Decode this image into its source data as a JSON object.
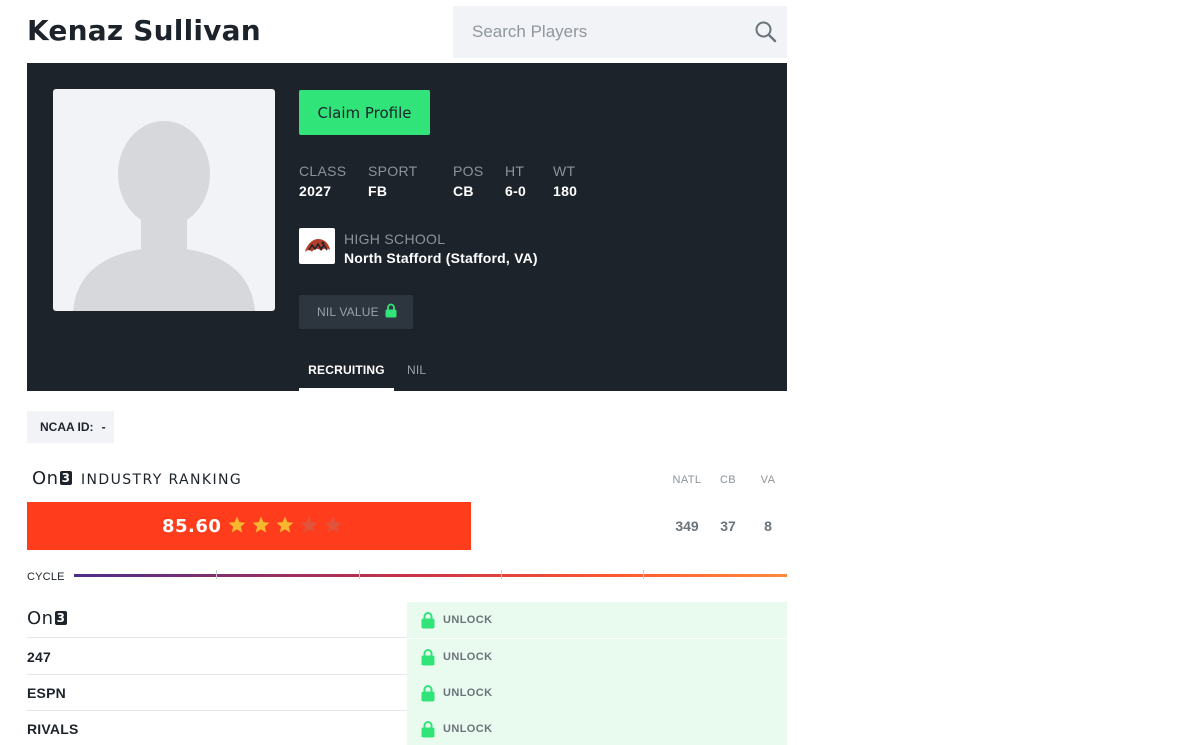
{
  "player": {
    "name": "Kenaz Sullivan"
  },
  "search": {
    "placeholder": "Search Players"
  },
  "profile": {
    "claim_label": "Claim Profile",
    "stats": [
      {
        "label": "CLASS",
        "value": "2027"
      },
      {
        "label": "SPORT",
        "value": "FB"
      },
      {
        "label": "POS",
        "value": "CB"
      },
      {
        "label": "HT",
        "value": "6-0"
      },
      {
        "label": "WT",
        "value": "180"
      }
    ],
    "high_school": {
      "label": "HIGH SCHOOL",
      "value": "North Stafford (Stafford, VA)"
    },
    "nil_label": "NIL VALUE",
    "tabs": [
      {
        "label": "RECRUITING",
        "active": true
      },
      {
        "label": "NIL",
        "active": false
      }
    ]
  },
  "ncaa": {
    "label": "NCAA ID:",
    "value": "-"
  },
  "ranking": {
    "brand": "On",
    "brand_num": "3",
    "title": "INDUSTRY RANKING",
    "score": "85.60",
    "stars": 3,
    "stars_total": 5,
    "columns": [
      {
        "label": "NATL",
        "value": "349"
      },
      {
        "label": "CB",
        "value": "37"
      },
      {
        "label": "VA",
        "value": "8"
      }
    ],
    "cycle_label": "CYCLE",
    "colors": {
      "bar": "#ff3c1c",
      "star_on": "#f5b82e",
      "star_off": "#e0543c"
    }
  },
  "sources": [
    {
      "name": "On3",
      "brand": "On",
      "brand_num": "3",
      "logo": true,
      "action": "UNLOCK"
    },
    {
      "name": "247",
      "logo": false,
      "action": "UNLOCK"
    },
    {
      "name": "ESPN",
      "logo": false,
      "action": "UNLOCK"
    },
    {
      "name": "RIVALS",
      "logo": false,
      "action": "UNLOCK"
    }
  ],
  "colors": {
    "dark": "#1d232a",
    "accent": "#30e47a",
    "unlock_bg": "#e9fbef"
  },
  "icons": {
    "search": "search-icon",
    "lock": "lock-icon",
    "star": "star-icon",
    "avatar": "avatar-placeholder-icon",
    "school": "school-logo"
  }
}
